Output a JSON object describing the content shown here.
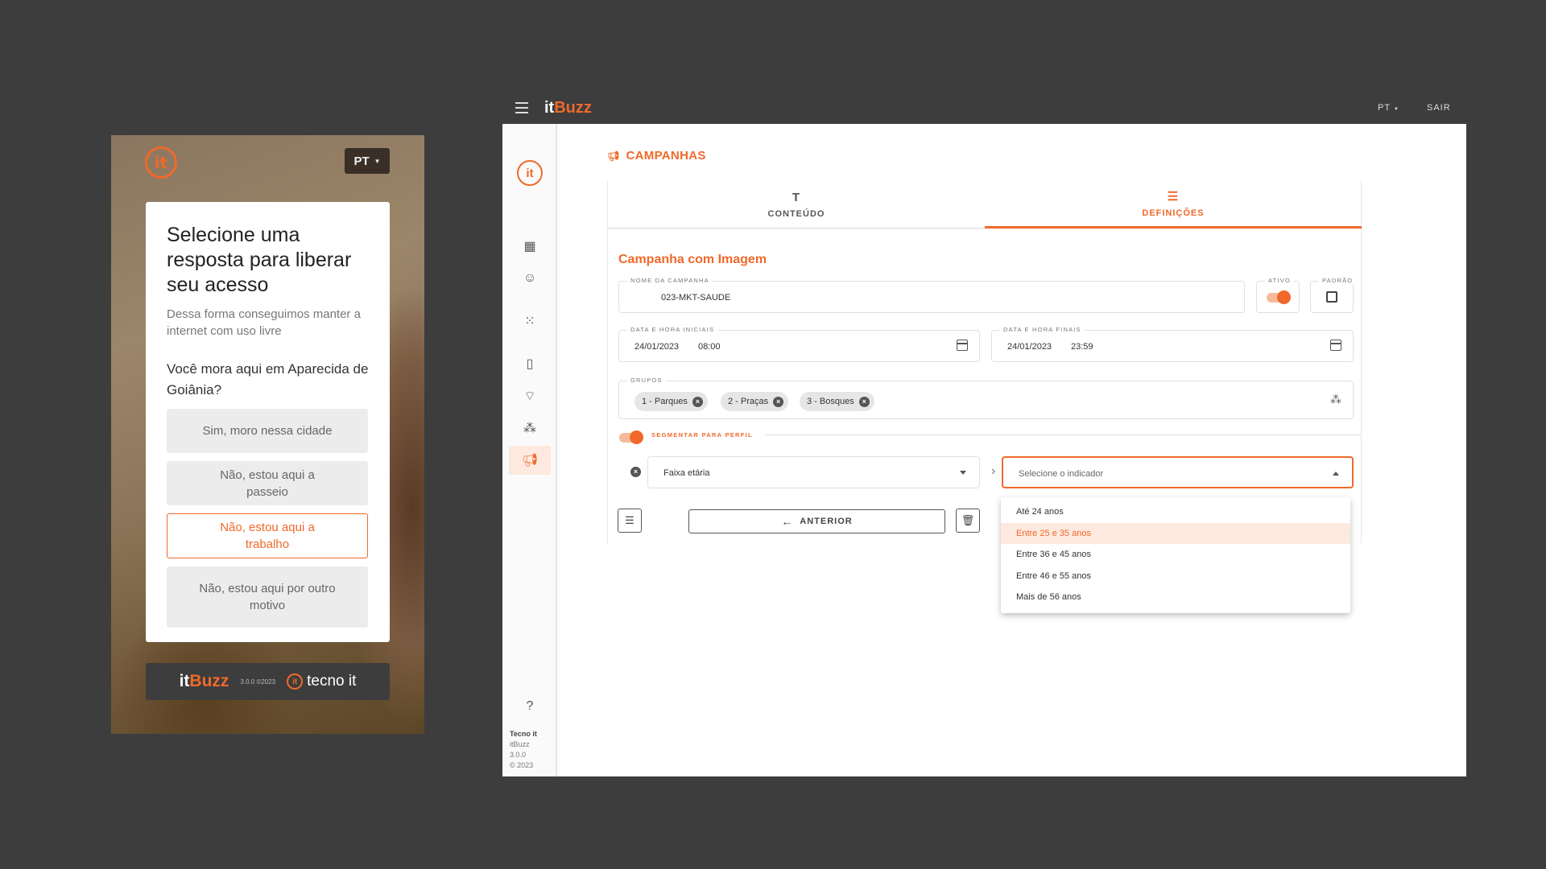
{
  "mobile": {
    "lang": "PT",
    "title": "Selecione uma resposta para liberar seu acesso",
    "subtitle": "Dessa forma conseguimos manter a internet com uso livre",
    "question": "Você mora aqui em Aparecida de Goiânia?",
    "options": [
      "Sim, moro nessa cidade",
      "Não, estou aqui a passeio",
      "Não, estou aqui a trabalho",
      "Não, estou aqui por outro motivo"
    ],
    "selected_option_index": 2,
    "footer": {
      "brand_it": "it",
      "brand_buzz": "Buzz",
      "version": "3.0.0 ©2023",
      "partner": "tecno it"
    }
  },
  "app": {
    "brand_it": "it",
    "brand_buzz": "Buzz",
    "lang": "PT",
    "exit": "SAIR",
    "sidebar_footer": {
      "company": "Tecno it",
      "product": "itBuzz",
      "version": "3.0.0",
      "copyright": "© 2023"
    },
    "page_title": "CAMPANHAS",
    "tabs": [
      {
        "label": "CONTEÚDO",
        "icon": "text-icon"
      },
      {
        "label": "DEFINIÇÕES",
        "icon": "tune-icon",
        "active": true
      }
    ],
    "campaign_title": "Campanha com Imagem",
    "name_field": {
      "label": "NOME DA CAMPANHA",
      "value": "023-MKT-SAUDE"
    },
    "active_label": "ATIVO",
    "active": true,
    "default_label": "PADRÃO",
    "default_checked": false,
    "start": {
      "label": "DATA E HORA INICIAIS",
      "date": "24/01/2023",
      "time": "08:00"
    },
    "end": {
      "label": "DATA E HORA FINAIS",
      "date": "24/01/2023",
      "time": "23:59"
    },
    "groups": {
      "label": "GRUPOS",
      "chips": [
        "1 - Parques",
        "2 - Praças",
        "3 - Bosques"
      ]
    },
    "segment": {
      "label": "SEGMENTAR PARA PERFIL",
      "enabled": true,
      "profile": "Faixa etária",
      "indicator_placeholder": "Selecione o indicador"
    },
    "buttons": {
      "previous": "ANTERIOR"
    },
    "dropdown_options": [
      "Até 24 anos",
      "Entre 25 e 35 anos",
      "Entre 36 e 45 anos",
      "Entre 46 e 55 anos",
      "Mais de 56 anos"
    ],
    "dropdown_highlighted_index": 1,
    "accent_color": "#f0692a"
  }
}
